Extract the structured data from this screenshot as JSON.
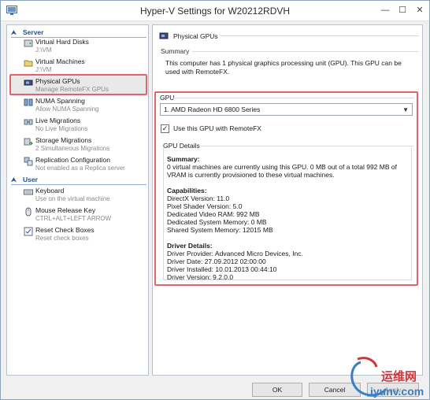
{
  "window": {
    "title": "Hyper-V Settings for W20212RDVH"
  },
  "controls": {
    "minimize": "—",
    "maximize": "☐",
    "close": "✕"
  },
  "sidebar": {
    "server_label": "Server",
    "user_label": "User",
    "chev": "⮝",
    "server_items": [
      {
        "name": "Virtual Hard Disks",
        "sub": "J:\\VM"
      },
      {
        "name": "Virtual Machines",
        "sub": "J:\\VM"
      },
      {
        "name": "Physical GPUs",
        "sub": "Manage RemoteFX GPUs"
      },
      {
        "name": "NUMA Spanning",
        "sub": "Allow NUMA Spanning"
      },
      {
        "name": "Live Migrations",
        "sub": "No Live Migrations"
      },
      {
        "name": "Storage Migrations",
        "sub": "2 Simultaneous Migrations"
      },
      {
        "name": "Replication Configuration",
        "sub": "Not enabled as a Replica server"
      }
    ],
    "user_items": [
      {
        "name": "Keyboard",
        "sub": "Use on the virtual machine"
      },
      {
        "name": "Mouse Release Key",
        "sub": "CTRL+ALT+LEFT ARROW"
      },
      {
        "name": "Reset Check Boxes",
        "sub": "Reset check boxes"
      }
    ]
  },
  "main": {
    "title": "Physical GPUs",
    "summary_label": "Summary",
    "summary_text": "This computer has 1 physical graphics processing unit (GPU). This GPU can be used with RemoteFX.",
    "gpu_label": "GPU",
    "gpu_selected": "1. AMD Radeon HD 6800 Series",
    "checkbox_checked": true,
    "checkbox_mark": "✓",
    "checkbox_label": "Use this GPU with RemoteFX",
    "details_label": "GPU Details",
    "details": {
      "summary_head": "Summary:",
      "summary_line1": "0 virtual machines are currently using this GPU. 0 MB out of a total 992 MB of",
      "summary_line2": "VRAM is currently provisioned to these virtual machines.",
      "capabilities_head": "Capabilities:",
      "capabilities": [
        "DirectX Version: 11.0",
        "Pixel Shader Version: 5.0",
        "Dedicated Video RAM: 992 MB",
        "Dedicated System Memory: 0 MB",
        "Shared System Memory: 12015 MB"
      ],
      "driver_head": "Driver Details:",
      "driver": [
        "Driver Provider: Advanced Micro Devices, Inc.",
        "Driver Date: 27.09.2012 02:00:00",
        "Driver Installed: 10.01.2013 00:44:10",
        "Driver Version: 9.2.0.0"
      ]
    }
  },
  "buttons": {
    "ok": "OK",
    "cancel": "Cancel",
    "apply": "Apply"
  },
  "watermark": {
    "top": "运维网",
    "bottom": "iyunv.com"
  },
  "colors": {
    "highlight": "#e2646b",
    "section": "#1f4e8c"
  }
}
